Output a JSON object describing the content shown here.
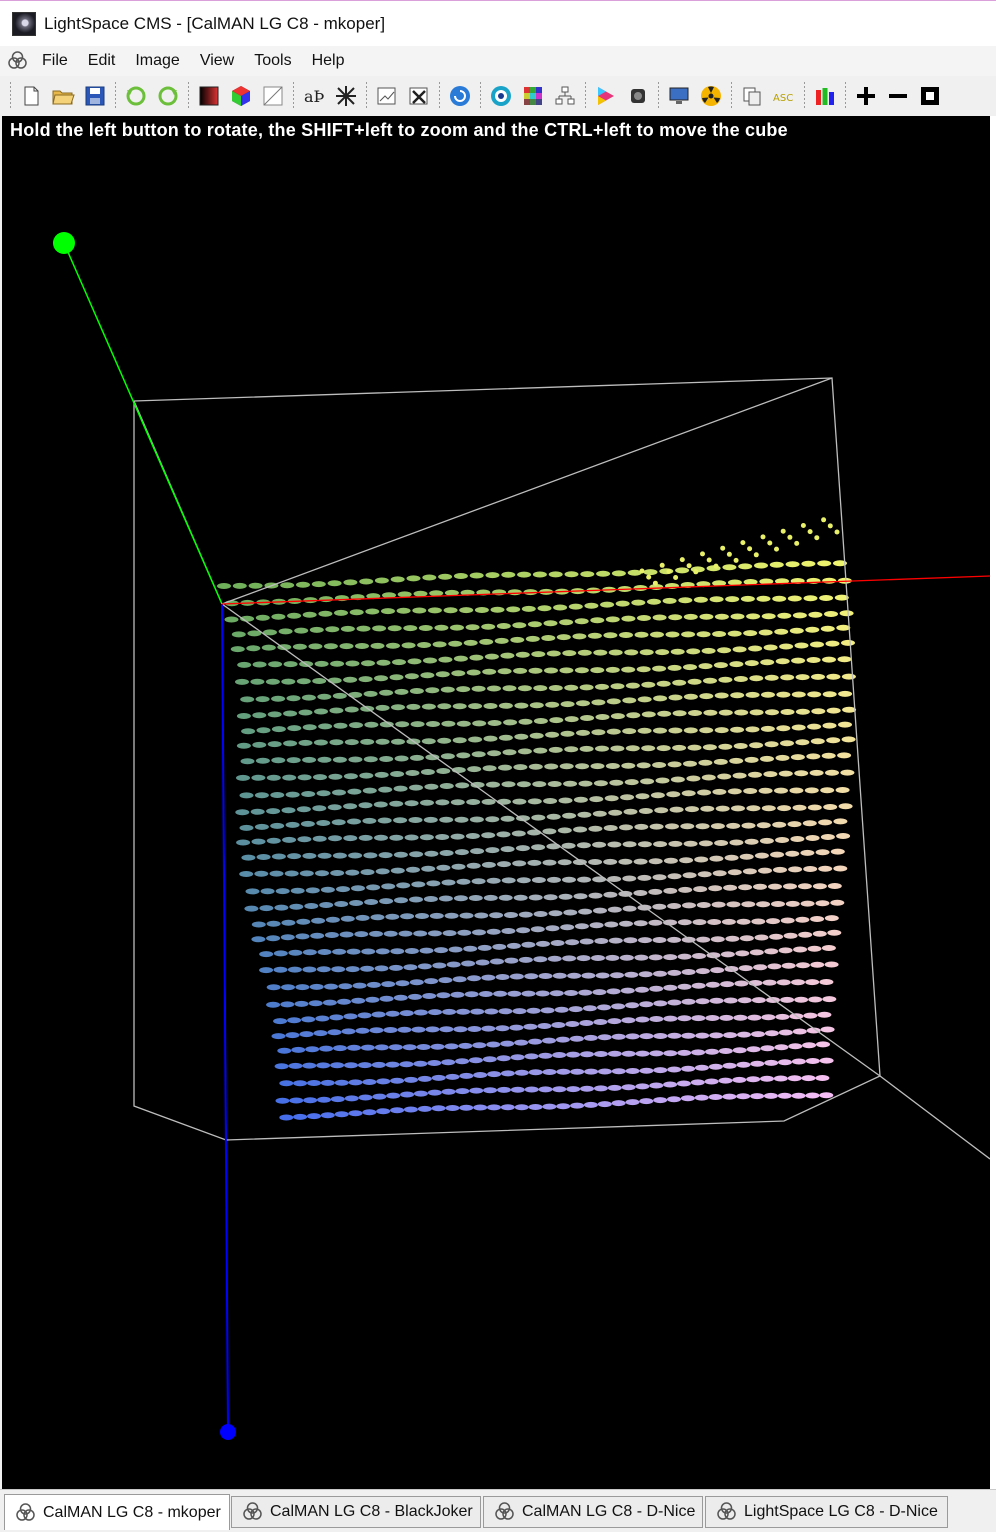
{
  "window": {
    "title": "LightSpace CMS - [CalMAN LG C8 - mkoper]"
  },
  "menu": {
    "items": [
      "File",
      "Edit",
      "Image",
      "View",
      "Tools",
      "Help"
    ]
  },
  "viewport": {
    "hint": "Hold the left button to rotate, the SHIFT+left to zoom and the CTRL+left to move the cube",
    "background": "#000000",
    "axes": {
      "green": "#00ff00",
      "blue": "#0000ff",
      "red": "#ff0000"
    }
  },
  "tabs": [
    {
      "label": "CalMAN LG C8 - mkoper",
      "active": true
    },
    {
      "label": "CalMAN LG C8 - BlackJoker",
      "active": false
    },
    {
      "label": "CalMAN LG C8 - D-Nice",
      "active": false
    },
    {
      "label": "LightSpace LG C8 - D-Nice",
      "active": false
    }
  ]
}
